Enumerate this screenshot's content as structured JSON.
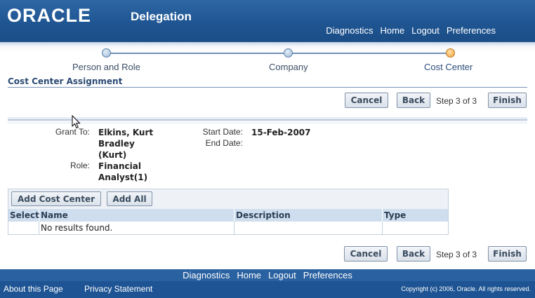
{
  "header": {
    "logo": "ORACLE",
    "title": "Delegation",
    "links": [
      "Diagnostics",
      "Home",
      "Logout",
      "Preferences"
    ]
  },
  "train": {
    "steps": [
      {
        "label": "Person and Role",
        "state": "done"
      },
      {
        "label": "Company",
        "state": "done"
      },
      {
        "label": "Cost Center",
        "state": "current"
      }
    ]
  },
  "section": {
    "title": "Cost Center Assignment"
  },
  "top_actions": {
    "cancel": "Cancel",
    "back": "Back",
    "step": "Step 3 of 3",
    "finish": "Finish"
  },
  "details": {
    "grant_to_label": "Grant To:",
    "grant_to_value": [
      "Elkins, Kurt",
      "Bradley",
      "(Kurt)"
    ],
    "role_label": "Role:",
    "role_value": [
      "Financial",
      "Analyst(1)"
    ],
    "start_date_label": "Start Date:",
    "start_date_value": "15-Feb-2007",
    "end_date_label": "End Date:",
    "end_date_value": ""
  },
  "table": {
    "buttons": {
      "add_cost_center": "Add Cost Center",
      "add_all": "Add All"
    },
    "columns": [
      "Select",
      "Name",
      "Description",
      "Type"
    ],
    "empty_message": "No results found."
  },
  "bottom_actions": {
    "cancel": "Cancel",
    "back": "Back",
    "step": "Step 3 of 3",
    "finish": "Finish"
  },
  "footer": {
    "links": [
      "Diagnostics",
      "Home",
      "Logout",
      "Preferences"
    ],
    "about": "About this Page",
    "privacy": "Privacy Statement",
    "copyright": "Copyright (c) 2006, Oracle. All rights reserved."
  },
  "colors": {
    "header_blue": "#1f5592",
    "train_current": "#f0a040",
    "section_title": "#2c4b74"
  }
}
